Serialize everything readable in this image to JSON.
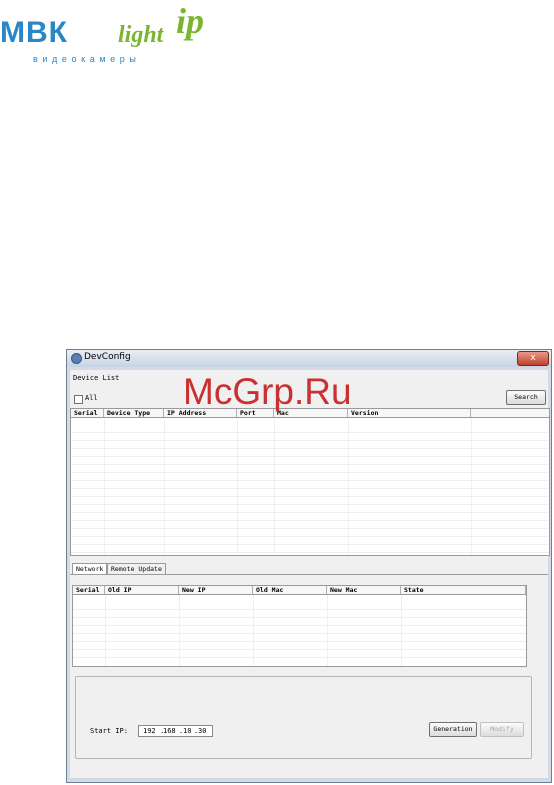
{
  "logo": {
    "main": "МВК",
    "light": "light",
    "ip": "ip",
    "sub": "видеокамеры"
  },
  "watermark": "McGrp.Ru",
  "window": {
    "title": "DevConfig",
    "close_glyph": "x",
    "device_list_label": "Device List",
    "all_label": "All",
    "search_label": "Search",
    "device_columns": [
      "Serial",
      "Device Type",
      "IP Address",
      "Port",
      "Mac",
      "Version"
    ],
    "tabs": [
      "Network",
      "Remote Update"
    ],
    "network_columns": [
      "Serial",
      "Old IP",
      "New IP",
      "Old Mac",
      "New Mac",
      "State"
    ],
    "start_ip_label": "Start IP:",
    "start_ip": [
      "192",
      "168",
      "10",
      "30"
    ],
    "generation_label": "Generation",
    "modify_label": "Modify"
  }
}
